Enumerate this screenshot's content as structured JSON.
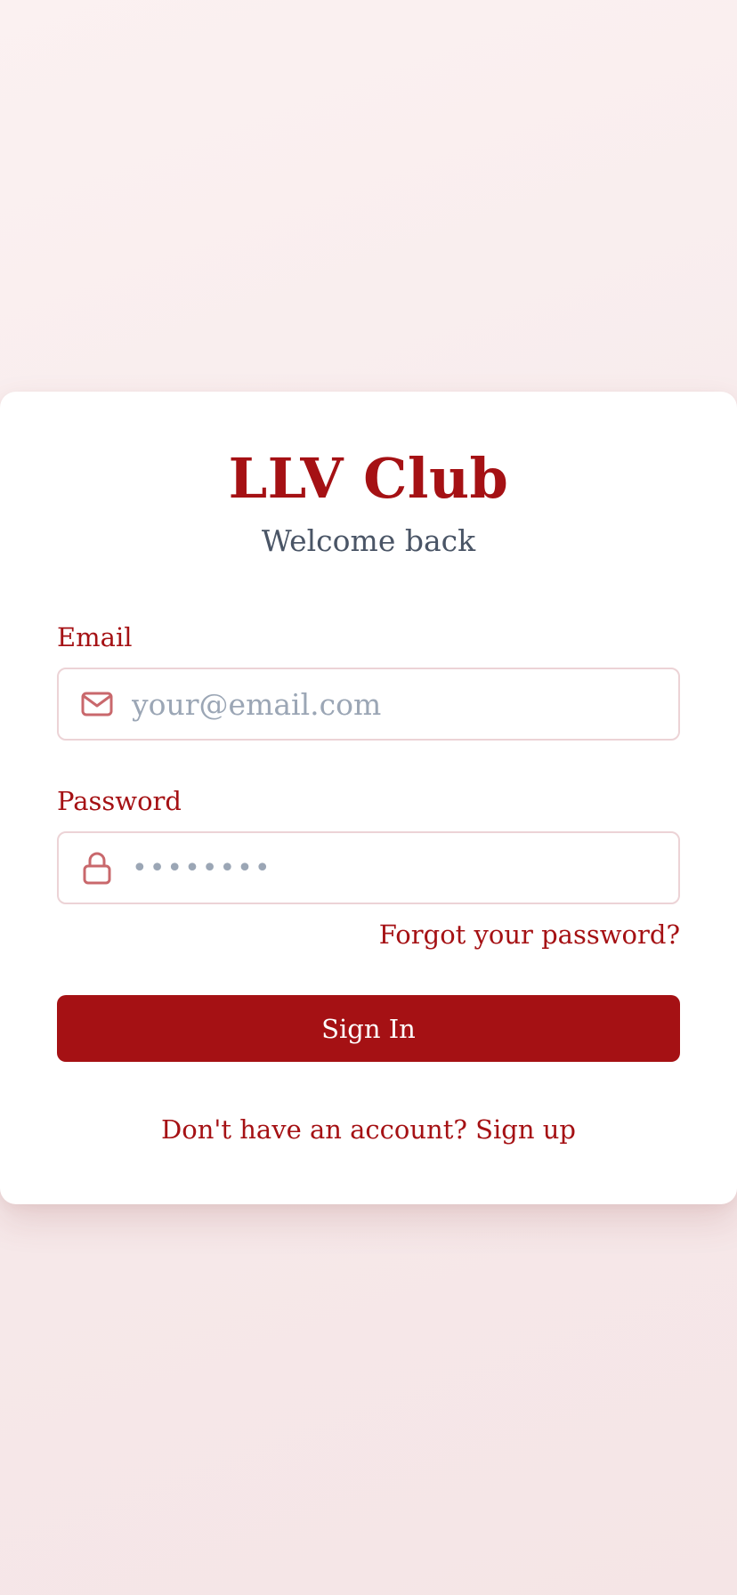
{
  "brand": {
    "title": "LLV Club",
    "subtitle": "Welcome back",
    "accent_color": "#a51114"
  },
  "form": {
    "email": {
      "label": "Email",
      "placeholder": "your@email.com",
      "value": "",
      "icon": "mail-icon"
    },
    "password": {
      "label": "Password",
      "placeholder": "••••••••",
      "value": "",
      "icon": "lock-icon"
    },
    "forgot_label": "Forgot your password?",
    "submit_label": "Sign In"
  },
  "footer": {
    "prompt": "Don't have an account?",
    "signup_label": "Sign up"
  }
}
